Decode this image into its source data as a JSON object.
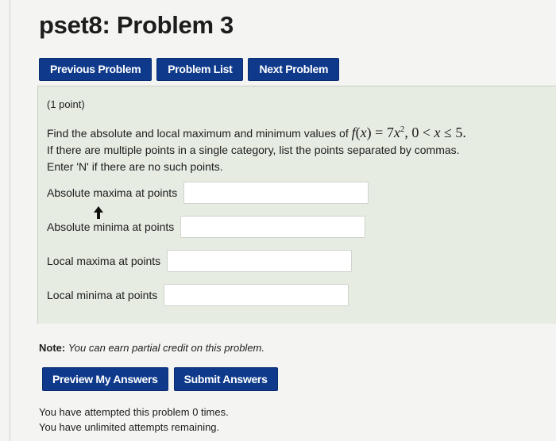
{
  "page": {
    "title": "pset8: Problem 3"
  },
  "nav": {
    "previous_label": "Previous Problem",
    "list_label": "Problem List",
    "next_label": "Next Problem"
  },
  "problem": {
    "points": "(1 point)",
    "statement_prefix": "Find the absolute and local maximum and minimum values of",
    "formula": "f(x) = 7x², 0 < x ≤ 5.",
    "line2": "If there are multiple points in a single category, list the points separated by commas.",
    "line3": "Enter 'N' if there are no such points.",
    "fields": [
      {
        "label": "Absolute maxima at points",
        "value": ""
      },
      {
        "label": "Absolute minima at points",
        "value": ""
      },
      {
        "label": "Local maxima at points",
        "value": ""
      },
      {
        "label": "Local minima at points",
        "value": ""
      }
    ]
  },
  "note": {
    "label": "Note:",
    "text": "You can earn partial credit on this problem."
  },
  "actions": {
    "preview_label": "Preview My Answers",
    "submit_label": "Submit Answers"
  },
  "status": {
    "attempts": "You have attempted this problem 0 times.",
    "remaining": "You have unlimited attempts remaining."
  },
  "colors": {
    "button_bg": "#0f3a8c",
    "problem_bg": "#e7ece3"
  },
  "icons": {
    "pointer": "mouse-pointer-icon"
  }
}
